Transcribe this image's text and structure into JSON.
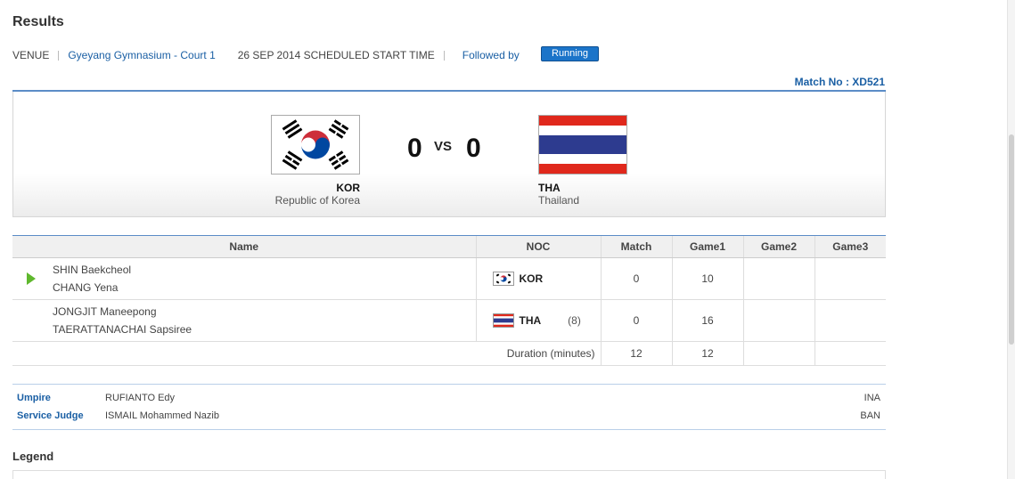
{
  "page": {
    "title": "Results"
  },
  "info": {
    "venue_label": "VENUE",
    "venue_name": "Gyeyang Gymnasium - Court 1",
    "date": "26 SEP 2014",
    "start_label": "SCHEDULED START TIME",
    "followed_by": "Followed by",
    "status": "Running"
  },
  "match_no": "Match No : XD521",
  "scoreboard": {
    "left": {
      "code": "KOR",
      "name": "Republic of Korea",
      "score": "0",
      "flag": "kor-flag-icon"
    },
    "vs": "VS",
    "right": {
      "code": "THA",
      "name": "Thailand",
      "score": "0",
      "flag": "tha-flag-icon"
    }
  },
  "table": {
    "headers": [
      "Name",
      "NOC",
      "Match",
      "Game1",
      "Game2",
      "Game3"
    ],
    "rows": [
      {
        "player1": "SHIN Baekcheol",
        "player2": "CHANG Yena",
        "noc": "KOR",
        "seed": "",
        "match": "0",
        "game1": "10",
        "game2": "",
        "game3": "",
        "serving": true
      },
      {
        "player1": "JONGJIT Maneepong",
        "player2": "TAERATTANACHAI Sapsiree",
        "noc": "THA",
        "seed": "(8)",
        "match": "0",
        "game1": "16",
        "game2": "",
        "game3": "",
        "serving": false
      }
    ],
    "duration": {
      "label": "Duration (minutes)",
      "match": "12",
      "game1": "12",
      "game2": "",
      "game3": ""
    }
  },
  "officials": [
    {
      "role": "Umpire",
      "name": "RUFIANTO Edy",
      "noc": "INA"
    },
    {
      "role": "Service Judge",
      "name": "ISMAIL Mohammed Nazib",
      "noc": "BAN"
    }
  ],
  "legend": {
    "title": "Legend"
  },
  "colors": {
    "accent": "#1a5fa4",
    "status_bg": "#1b74c9",
    "serve_arrow": "#5fb82d",
    "tha_red": "#e0281c",
    "tha_blue": "#2d3b8f",
    "kor_red": "#cd2e3a",
    "kor_blue": "#0047a0"
  }
}
